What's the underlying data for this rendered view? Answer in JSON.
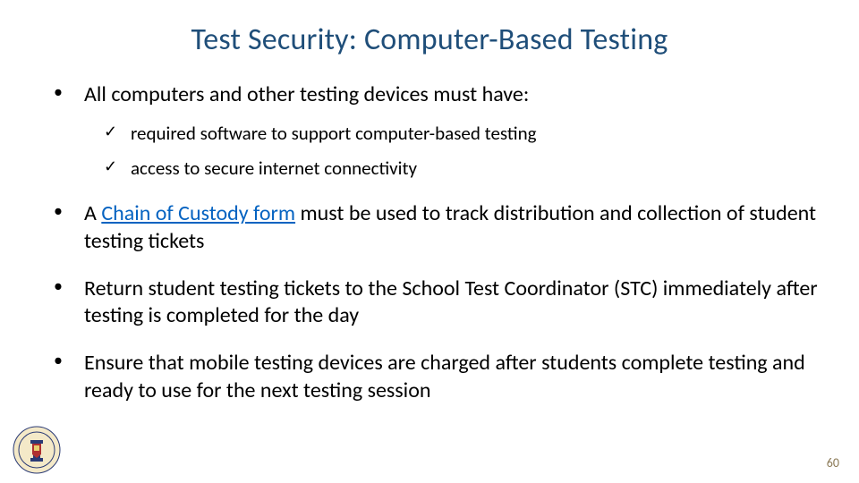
{
  "title": "Test Security: Computer-Based Testing",
  "bullets": [
    {
      "text": "All computers and other testing devices must have:",
      "sub": [
        "required software to support computer-based testing",
        "access to secure internet connectivity"
      ]
    },
    {
      "prefix": "A ",
      "link": "Chain of Custody form",
      "suffix": " must be used to track distribution and collection of student testing tickets"
    },
    {
      "text": "Return student testing tickets to the School Test Coordinator (STC) immediately after testing is completed for the day"
    },
    {
      "text": "Ensure that mobile testing devices are charged after students complete testing and ready to use for the next testing session"
    }
  ],
  "page_number": "60"
}
